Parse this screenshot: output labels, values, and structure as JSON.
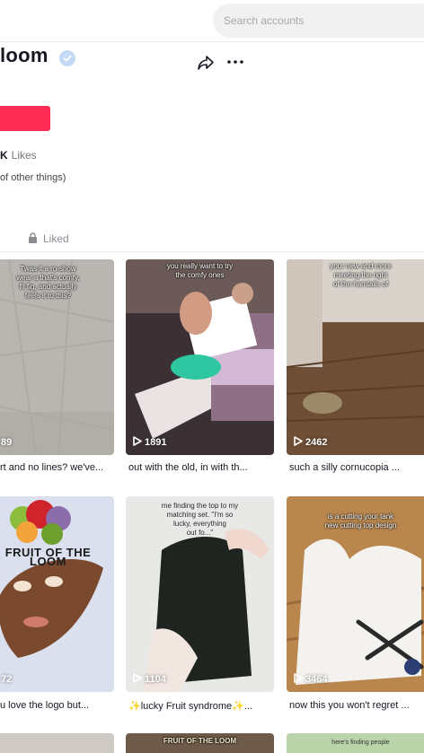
{
  "search": {
    "placeholder": "Search accounts"
  },
  "profile": {
    "name": "loom",
    "likes_count": "K",
    "likes_label": "Likes",
    "bio": "of other things)"
  },
  "tabs": {
    "liked": "Liked"
  },
  "videos": [
    {
      "views": "89",
      "thumb_text": "Twas it a ro-show\nwear a that's comfy,\nfit fig, and actually\nfeels it to this?",
      "caption": "rt and no lines? we've..."
    },
    {
      "views": "1891",
      "thumb_text": "you really want to try\nthe comfy ones",
      "caption": "out with the old, in with th..."
    },
    {
      "views": "2462",
      "thumb_text": "your new and more\nmeeting the right\nof the hamtails of",
      "caption": "such a silly cornucopia ..."
    },
    {
      "views": "72",
      "thumb_text": "FRUIT OF THE LOOM",
      "caption": "u love the logo but..."
    },
    {
      "views": "1104",
      "thumb_text": "me finding the top to my\nmatching set. \"I'm so\nlucky, everything\nout fo...\"",
      "caption": "✨lucky Fruit syndrome✨..."
    },
    {
      "views": "3464",
      "thumb_text": "is a cutting your tank\nnew cutting top design",
      "caption": "now this you won't regret ..."
    }
  ],
  "bottom_row": [
    {
      "thumb_text": ""
    },
    {
      "thumb_text": "FRUIT OF THE LOOM"
    },
    {
      "thumb_text": "here's finding people"
    }
  ],
  "colors": {
    "follow": "#fe2c55",
    "verified": "#20d5ec",
    "text": "#161823",
    "muted": "#8a8b91"
  },
  "icons": [
    "verified-badge-icon",
    "share-icon",
    "more-icon",
    "lock-icon",
    "play-icon"
  ]
}
